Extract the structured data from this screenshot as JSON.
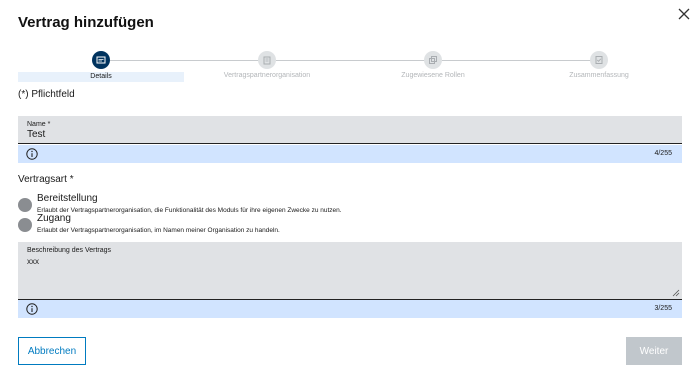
{
  "dialog": {
    "title": "Vertrag hinzufügen"
  },
  "stepper": {
    "steps": [
      {
        "label": "Details",
        "icon": "form-icon",
        "active": true
      },
      {
        "label": "Vertragspartnerorganisation",
        "icon": "building-icon",
        "active": false
      },
      {
        "label": "Zugewiesene Rollen",
        "icon": "roles-icon",
        "active": false
      },
      {
        "label": "Zusammenfassung",
        "icon": "summary-icon",
        "active": false
      }
    ]
  },
  "form": {
    "required_note": "(*) Pflichtfeld",
    "name": {
      "label": "Name *",
      "value": "Test",
      "counter": "4/255"
    },
    "contract_type": {
      "label": "Vertragsart *",
      "options": [
        {
          "title": "Bereitstellung",
          "description": "Erlaubt der Vertragspartnerorganisation, die Funktionalität des Moduls für ihre eigenen Zwecke zu nutzen."
        },
        {
          "title": "Zugang",
          "description": "Erlaubt der Vertragspartnerorganisation, im Namen meiner Organisation zu handeln."
        }
      ]
    },
    "description": {
      "label": "Beschreibung des Vertrags",
      "value": "xxx",
      "counter": "3/255"
    }
  },
  "actions": {
    "cancel_label": "Abbrechen",
    "next_label": "Weiter"
  },
  "colors": {
    "accent": "#007bc0",
    "active_step": "#00335e",
    "hint_background": "#d1e4ff",
    "field_background": "#e0e2e5",
    "disabled_button": "#c1c7cc"
  }
}
